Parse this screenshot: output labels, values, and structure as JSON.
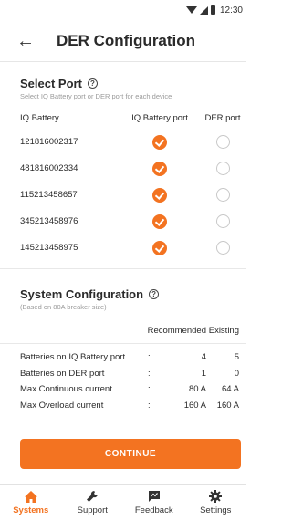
{
  "status_bar": {
    "time": "12:30",
    "icons": [
      "wifi-icon",
      "signal-icon",
      "battery-icon"
    ]
  },
  "app_bar": {
    "title": "DER Configuration",
    "back_icon": "back-arrow-icon"
  },
  "select_port": {
    "title": "Select Port",
    "subtitle": "Select IQ Battery port or DER port for each device",
    "columns": [
      "IQ Battery",
      "IQ Battery port",
      "DER port"
    ],
    "rows": [
      {
        "serial": "121816002317",
        "iq_battery_port": true,
        "der_port": false
      },
      {
        "serial": "481816002334",
        "iq_battery_port": true,
        "der_port": false
      },
      {
        "serial": "115213458657",
        "iq_battery_port": true,
        "der_port": false
      },
      {
        "serial": "345213458976",
        "iq_battery_port": true,
        "der_port": false
      },
      {
        "serial": "145213458975",
        "iq_battery_port": true,
        "der_port": false
      }
    ]
  },
  "system_configuration": {
    "title": "System Configuration",
    "subtitle": "(Based on 80A breaker size)",
    "columns": [
      "Recommended",
      "Existing"
    ],
    "rows": [
      {
        "label": "Batteries on IQ Battery port",
        "colon": ":",
        "recommended": "4",
        "existing": "5"
      },
      {
        "label": "Batteries on DER port",
        "colon": ":",
        "recommended": "1",
        "existing": "0"
      },
      {
        "label": "Max Continuous current",
        "colon": ":",
        "recommended": "80 A",
        "existing": "64 A"
      },
      {
        "label": "Max Overload current",
        "colon": ":",
        "recommended": "160 A",
        "existing": "160 A"
      }
    ]
  },
  "continue_label": "CONTINUE",
  "bottom_nav": [
    {
      "label": "Systems",
      "icon": "home-icon",
      "active": true
    },
    {
      "label": "Support",
      "icon": "wrench-icon",
      "active": false
    },
    {
      "label": "Feedback",
      "icon": "feedback-icon",
      "active": false
    },
    {
      "label": "Settings",
      "icon": "gear-icon",
      "active": false
    }
  ],
  "colors": {
    "accent": "#f37321",
    "text": "#2a2a2a",
    "muted": "#9a9a9a"
  }
}
